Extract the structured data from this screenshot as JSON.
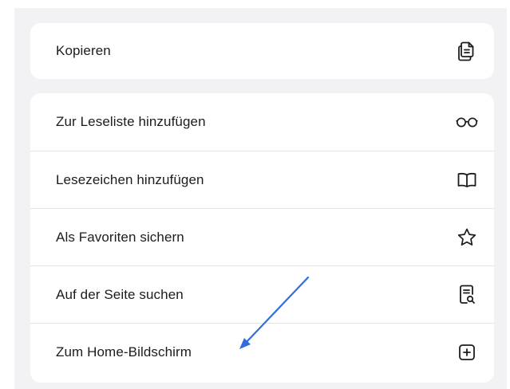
{
  "menu": {
    "copy": {
      "label": "Kopieren",
      "icon": "copy-icon"
    },
    "items": [
      {
        "label": "Zur Leseliste hinzufügen",
        "icon": "glasses-icon"
      },
      {
        "label": "Lesezeichen hinzufügen",
        "icon": "book-icon"
      },
      {
        "label": "Als Favoriten sichern",
        "icon": "star-icon"
      },
      {
        "label": "Auf der Seite suchen",
        "icon": "find-in-page-icon"
      },
      {
        "label": "Zum Home-Bildschirm",
        "icon": "add-square-icon"
      }
    ]
  },
  "annotation": {
    "color": "#2f6fdc"
  }
}
